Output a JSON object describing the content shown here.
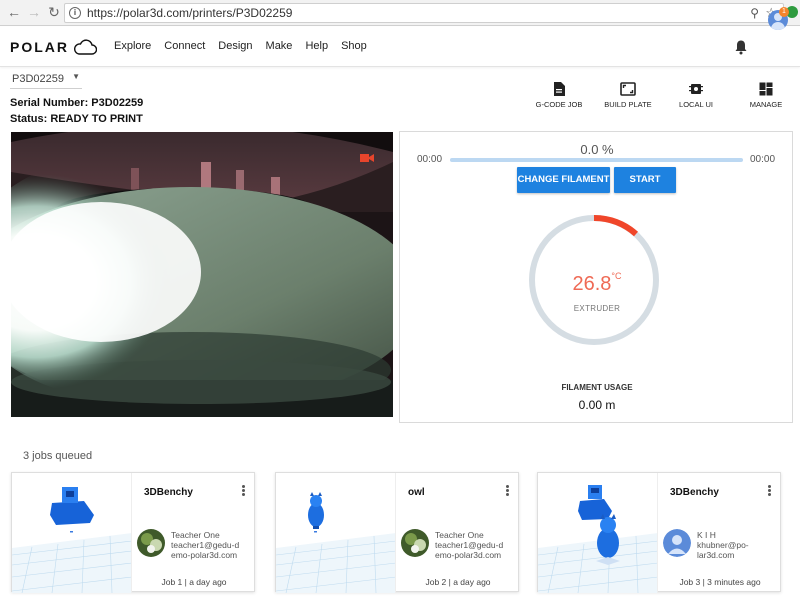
{
  "browser": {
    "url": "https://polar3d.com/printers/P3D02259"
  },
  "header": {
    "logo_text": "POLAR",
    "nav": [
      "Explore",
      "Connect",
      "Design",
      "Make",
      "Help",
      "Shop"
    ],
    "notification_count": "1"
  },
  "printer": {
    "selected": "P3D02259",
    "serial": "Serial Number: P3D02259",
    "status": "Status: READY TO PRINT"
  },
  "toolbar": {
    "gcode_job": "G-CODE JOB",
    "build_plate": "BUILD PLATE",
    "local_ui": "LOCAL UI",
    "manage": "MANAGE"
  },
  "control": {
    "progress_text": "0.0 %",
    "progress_value": 0,
    "time_elapsed": "00:00",
    "time_remaining": "00:00",
    "change_filament_label": "CHANGE FILAMENT",
    "start_label": "START",
    "temperature": "26.8",
    "temperature_unit": "°C",
    "temperature_label": "EXTRUDER",
    "filament_usage_label": "FILAMENT USAGE",
    "filament_usage_value": "0.00 m"
  },
  "colors": {
    "accent_blue": "#1e82e0",
    "gauge_red": "#f0462a",
    "temp_text": "#ef6a55",
    "badge_orange": "#f5852c"
  },
  "queue": {
    "title": "3 jobs queued",
    "jobs": [
      {
        "name": "3DBenchy",
        "owner_name": "Teacher One",
        "owner_email": "teacher1@gedu-demo-polar3d.com",
        "owner_email_line1": "teacher1@gedu-d",
        "owner_email_line2": "emo-polar3d.com",
        "footer": "Job 1 | a day ago"
      },
      {
        "name": "owl",
        "owner_name": "Teacher One",
        "owner_email": "teacher1@gedu-demo-polar3d.com",
        "owner_email_line1": "teacher1@gedu-d",
        "owner_email_line2": "emo-polar3d.com",
        "footer": "Job 2 | a day ago"
      },
      {
        "name": "3DBenchy",
        "owner_name": "K I H",
        "owner_email": "khubner@polar3d.com",
        "owner_email_line1": "khubner@po-",
        "owner_email_line2": "lar3d.com",
        "footer": "Job 3 | 3 minutes ago"
      }
    ]
  }
}
